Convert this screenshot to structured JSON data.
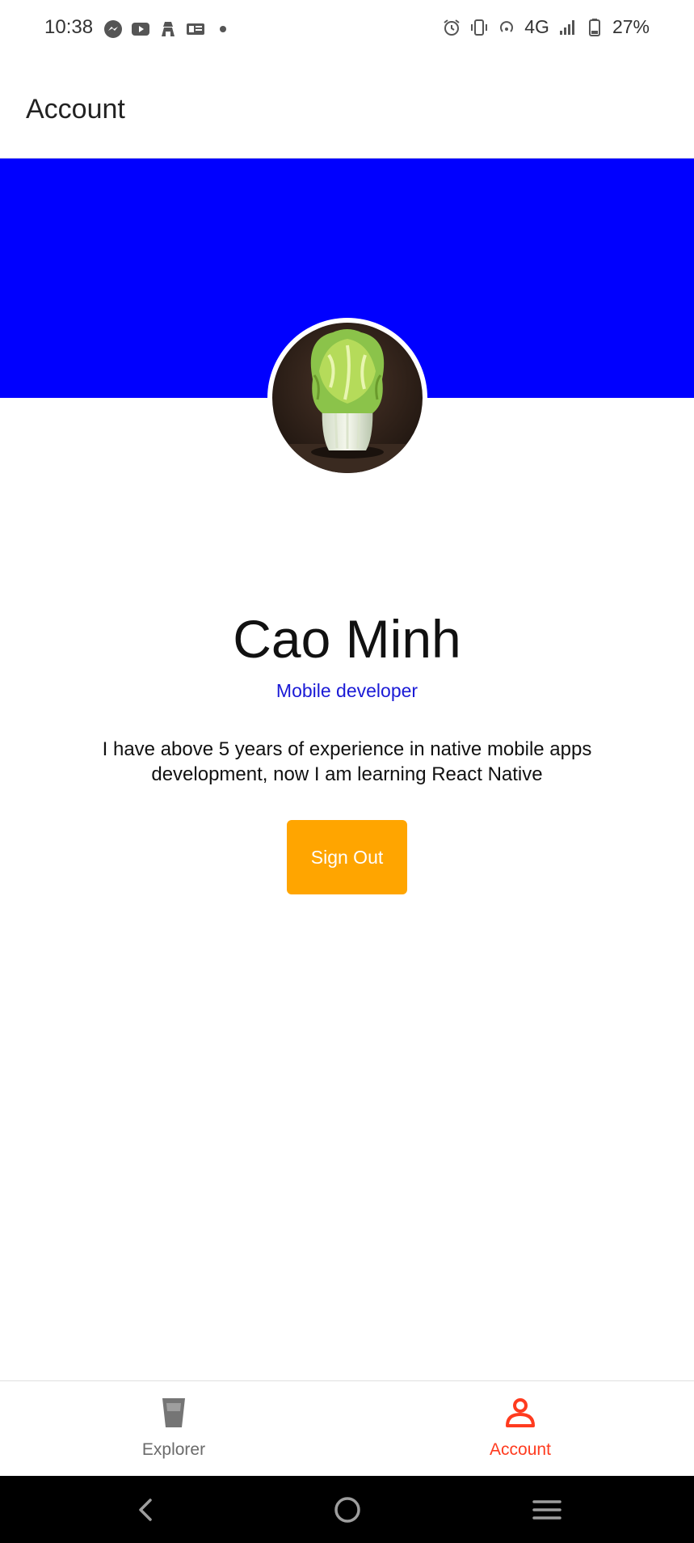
{
  "status_bar": {
    "time": "10:38",
    "network": "4G",
    "battery": "27%",
    "left_icons": [
      "messenger-icon",
      "youtube-icon",
      "vpn-icon",
      "news-icon",
      "dot-icon"
    ],
    "right_icons": [
      "alarm-icon",
      "vibrate-icon",
      "hotspot-icon",
      "signal-icon",
      "battery-icon"
    ]
  },
  "header": {
    "title": "Account"
  },
  "cover": {
    "color": "#0000ff"
  },
  "profile": {
    "name": "Cao Minh",
    "role": "Mobile developer",
    "bio": "I have above 5 years of experience in native mobile apps development, now I am learning React Native",
    "avatar_icon": "cabbage-avatar"
  },
  "actions": {
    "sign_out_label": "Sign Out",
    "sign_out_color": "#ffa500"
  },
  "tabs": [
    {
      "label": "Explorer",
      "icon": "glass-icon",
      "active": false
    },
    {
      "label": "Account",
      "icon": "person-icon",
      "active": true,
      "active_color": "#ff3b1f"
    }
  ],
  "nav": {
    "buttons": [
      "back-icon",
      "home-icon",
      "recents-icon"
    ]
  }
}
